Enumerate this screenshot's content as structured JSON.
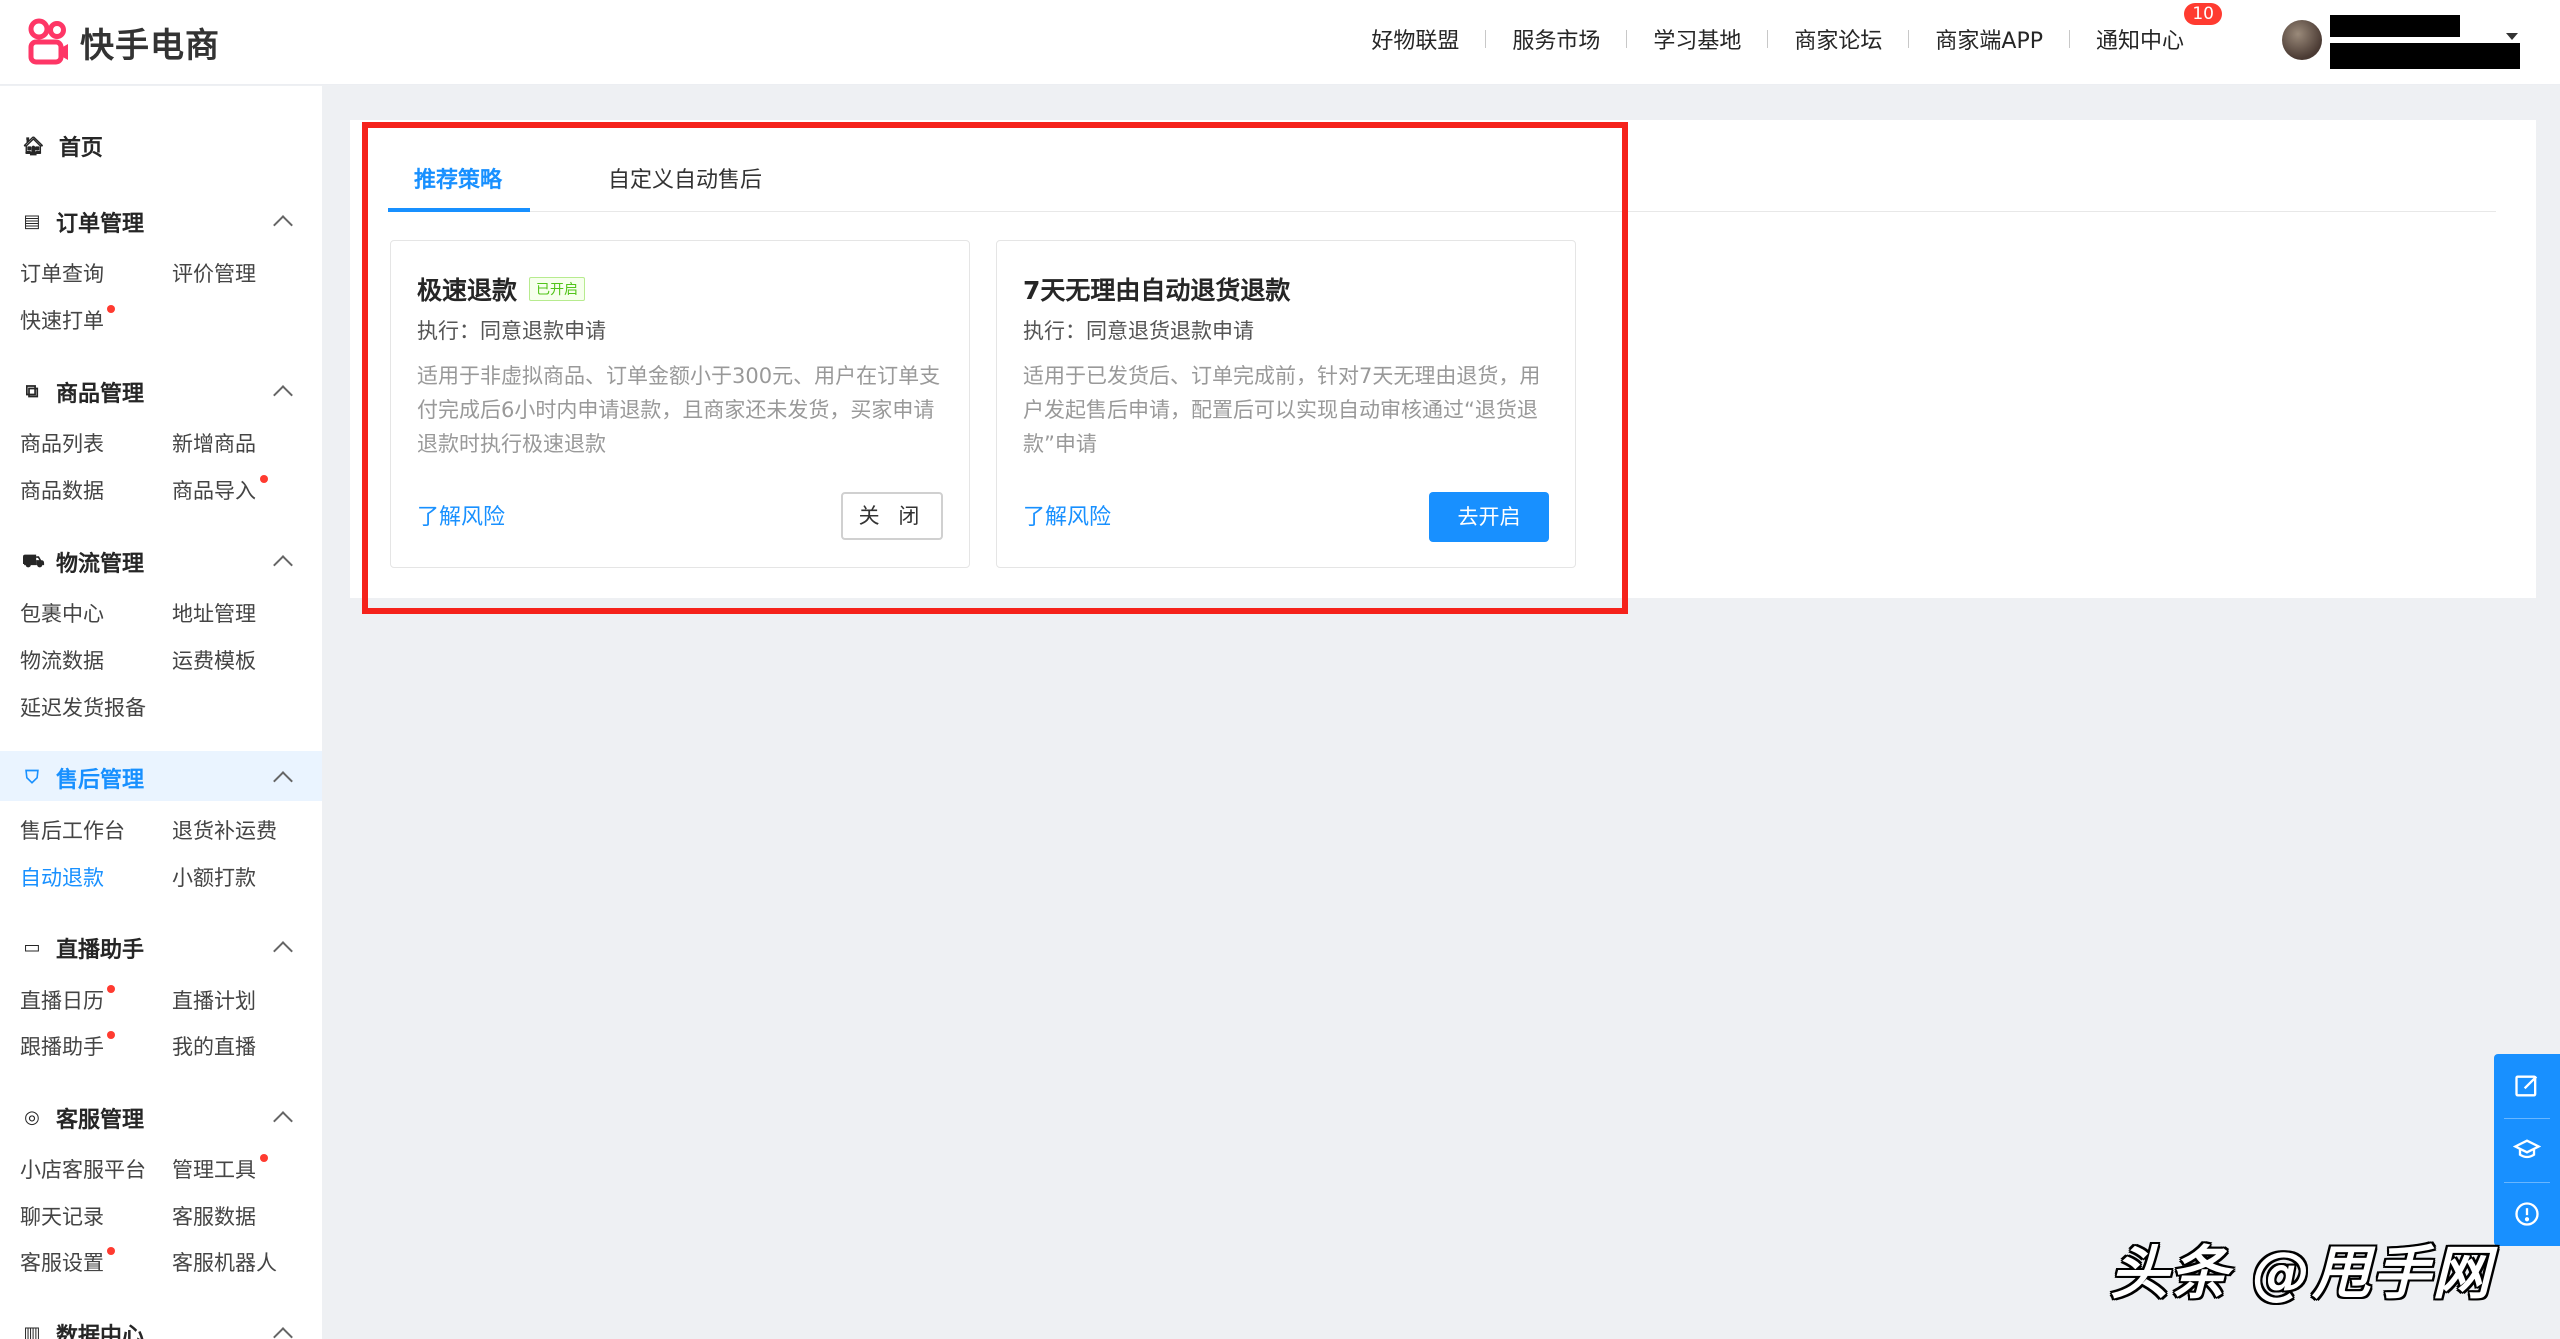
{
  "brand": {
    "name": "快手电商",
    "accent": "#fe3666",
    "primary": "#1890ff"
  },
  "topnav": {
    "items": [
      "好物联盟",
      "服务市场",
      "学习基地",
      "商家论坛",
      "商家端APP",
      "通知中心"
    ],
    "notification_badge": "10"
  },
  "sidebar": {
    "home": "首页",
    "groups": [
      {
        "title": "订单管理",
        "icon": "order-icon",
        "items": [
          "订单查询",
          "评价管理",
          "快速打单"
        ]
      },
      {
        "title": "商品管理",
        "icon": "goods-icon",
        "items": [
          "商品列表",
          "新增商品",
          "商品数据",
          "商品导入"
        ]
      },
      {
        "title": "物流管理",
        "icon": "truck-icon",
        "items": [
          "包裹中心",
          "地址管理",
          "物流数据",
          "运费模板",
          "延迟发货报备"
        ]
      },
      {
        "title": "售后管理",
        "icon": "shield-icon",
        "items": [
          "售后工作台",
          "退货补运费",
          "自动退款",
          "小额打款"
        ]
      },
      {
        "title": "直播助手",
        "icon": "live-icon",
        "items": [
          "直播日历",
          "直播计划",
          "跟播助手",
          "我的直播"
        ]
      },
      {
        "title": "客服管理",
        "icon": "chat-icon",
        "items": [
          "小店客服平台",
          "管理工具",
          "聊天记录",
          "客服数据",
          "客服设置",
          "客服机器人"
        ]
      },
      {
        "title": "数据中心",
        "icon": "chart-icon",
        "items": []
      }
    ]
  },
  "tabs": [
    "推荐策略",
    "自定义自动售后"
  ],
  "cards": [
    {
      "title": "极速退款",
      "status": "已开启",
      "exec": "执行：同意退款申请",
      "desc": "适用于非虚拟商品、订单金额小于300元、用户在订单支付完成后6小时内申请退款，且商家还未发货，买家申请退款时执行极速退款",
      "risk_link": "了解风险",
      "action": "关 闭"
    },
    {
      "title": "7天无理由自动退货退款",
      "exec": "执行：同意退货退款申请",
      "desc": "适用于已发货后、订单完成前，针对7天无理由退货，用户发起售后申请，配置后可以实现自动审核通过“退货退款”申请",
      "risk_link": "了解风险",
      "action": "去开启"
    }
  ],
  "float_tools": [
    "edit-icon",
    "graduation-cap-icon",
    "info-icon"
  ],
  "watermark": "头条 @甩手网"
}
